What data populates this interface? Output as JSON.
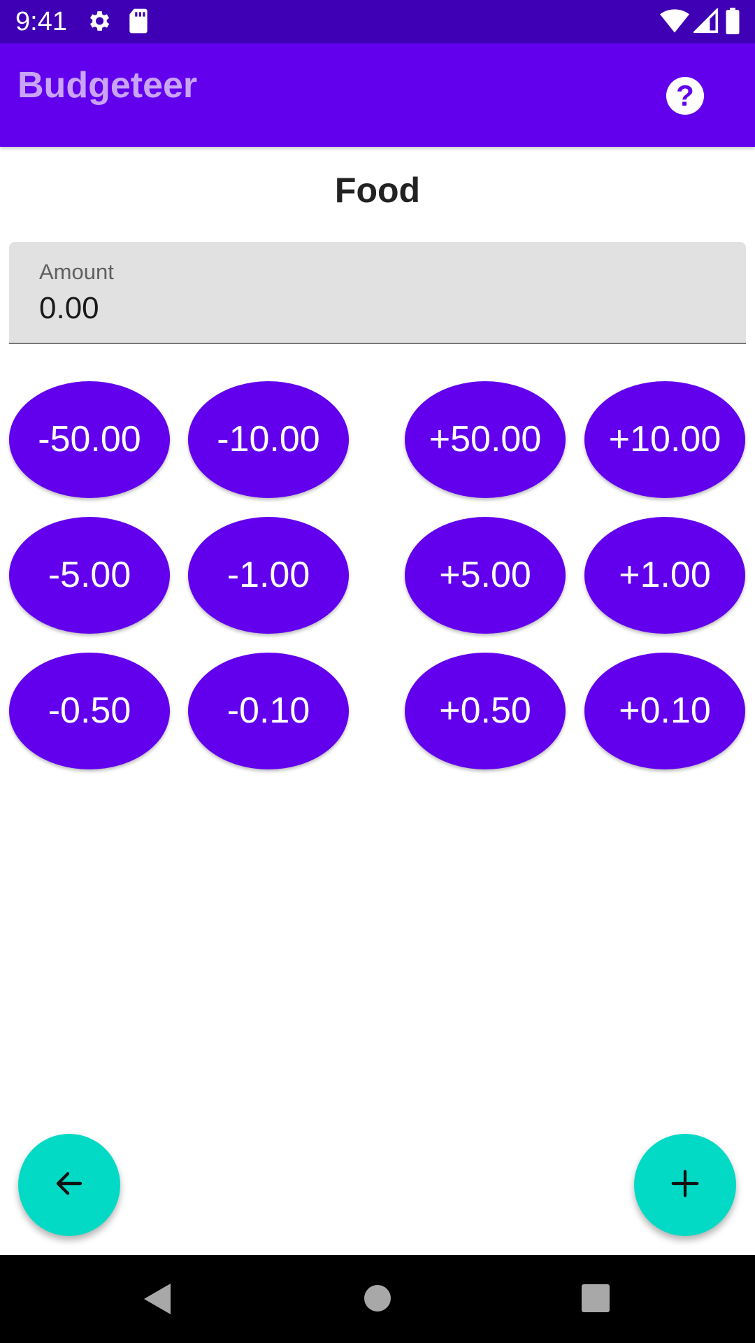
{
  "status_bar": {
    "time": "9:41",
    "icons": [
      "gear-icon",
      "sd-card-icon",
      "wifi-icon",
      "signal-icon",
      "battery-icon"
    ]
  },
  "app_bar": {
    "title": "Budgeteer",
    "help_icon": "help-circle-icon"
  },
  "category": {
    "title": "Food"
  },
  "amount_field": {
    "label": "Amount",
    "value": "0.00"
  },
  "buttons": {
    "minus_50": "-50.00",
    "minus_10": "-10.00",
    "plus_50": "+50.00",
    "plus_10": "+10.00",
    "minus_5": "-5.00",
    "minus_1": "-1.00",
    "plus_5": "+5.00",
    "plus_1": "+1.00",
    "minus_050": "-0.50",
    "minus_010": "-0.10",
    "plus_050": "+0.50",
    "plus_010": "+0.10"
  },
  "fabs": {
    "back_icon": "arrow-left-icon",
    "add_icon": "plus-icon"
  },
  "nav_bar": {
    "icons": [
      "back-triangle-icon",
      "home-circle-icon",
      "recents-square-icon"
    ]
  },
  "colors": {
    "status_bar": "#3f00b5",
    "primary": "#6200ee",
    "app_title": "#c9a4f7",
    "fab": "#03dac5",
    "field_bg": "#e1e1e1"
  }
}
